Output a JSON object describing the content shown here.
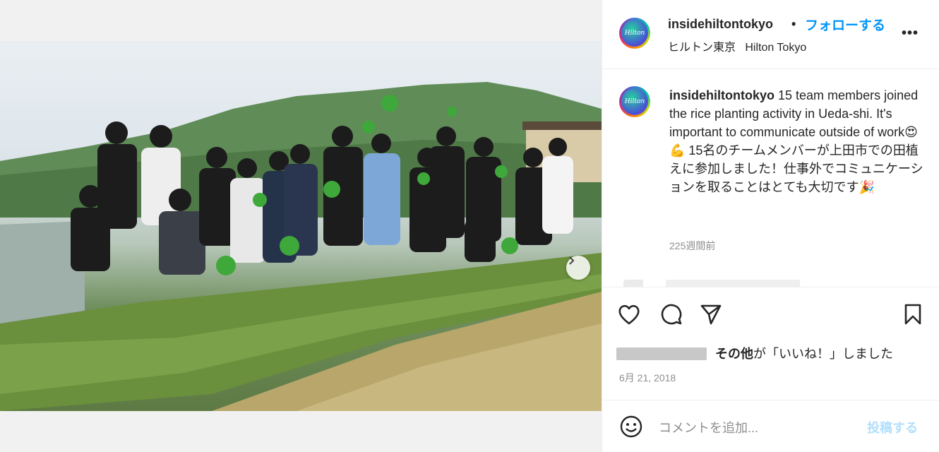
{
  "post": {
    "username": "insidehiltontokyo",
    "separator": "•",
    "follow_label": "フォローする",
    "location_ja": "ヒルトン東京",
    "location_en": "Hilton Tokyo",
    "more_label": "•••",
    "avatar_text": "Hilton"
  },
  "caption": {
    "username": "insidehiltontokyo",
    "text": " 15 team members joined the rice planting activity in Ueda-shi. It's important to communicate outside of work😍💪 15名のチームメンバーが上田市での田植えに参加しました！仕事外でコミュニケーションを取ることはとても大切です🎉",
    "time_ago": "225週間前"
  },
  "actions": {
    "likes_text": "その他が「いいね！」しました",
    "likes_bold": "その他",
    "likes_rest": "が「いいね！」しました",
    "date": "6月 21, 2018"
  },
  "comment": {
    "placeholder": "コメントを追加...",
    "post_label": "投稿する"
  },
  "media": {
    "slide_count": 2,
    "active_slide": 1
  },
  "icons": [
    "heart-icon",
    "comment-icon",
    "share-icon",
    "bookmark-icon",
    "chevron-right-icon",
    "emoji-icon",
    "more-icon"
  ],
  "colors": {
    "accent": "#0095f6",
    "post_disabled": "#b2dffc",
    "muted": "#8e8e8e"
  }
}
